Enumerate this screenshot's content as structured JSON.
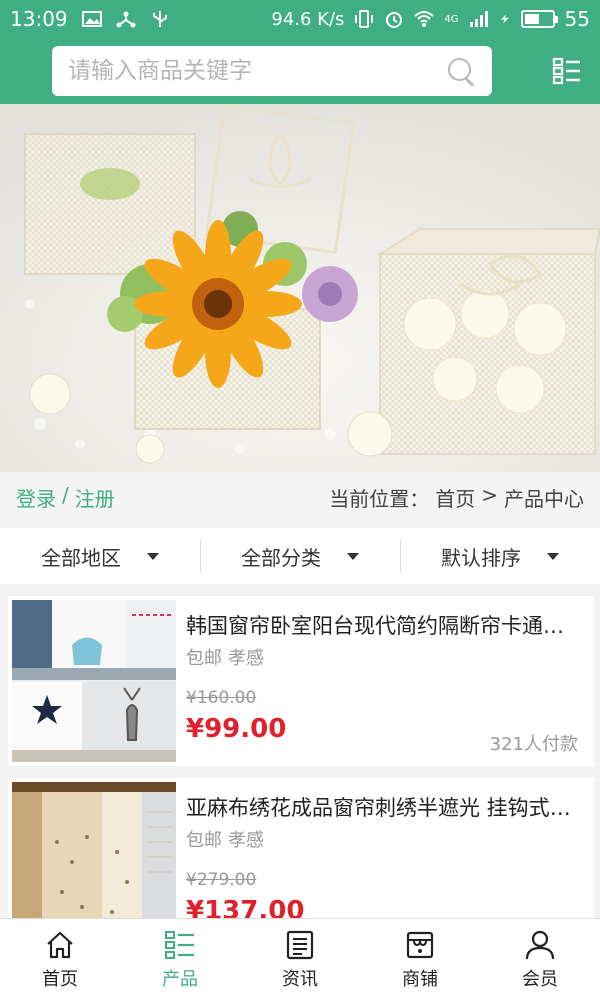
{
  "status_bar": {
    "time": "13:09",
    "speed": "94.6 K/s",
    "network": "4G",
    "battery": "55",
    "battery_level": 0.55
  },
  "search": {
    "placeholder": "请输入商品关键字"
  },
  "info_bar": {
    "login": "登录",
    "separator": "/",
    "register": "注册",
    "location_label": "当前位置：",
    "crumb_home": "首页",
    "crumb_sep": ">",
    "crumb_current": "产品中心"
  },
  "filters": [
    {
      "label": "全部地区"
    },
    {
      "label": "全部分类"
    },
    {
      "label": "默认排序"
    }
  ],
  "products": [
    {
      "name": "韩国窗帘卧室阳台现代简约隔断帘卡通窗帘",
      "shipping": "包邮",
      "location": "孝感",
      "old_price": "¥160.00",
      "price": "¥99.00",
      "sold": "321人付款"
    },
    {
      "name": "亚麻布绣花成品窗帘刺绣半遮光 挂钩式窗帘",
      "shipping": "包邮",
      "location": "孝感",
      "old_price": "¥279.00",
      "price": "¥137.00",
      "sold": ""
    }
  ],
  "tabs": [
    {
      "label": "首页",
      "icon": "home-icon",
      "active": false
    },
    {
      "label": "产品",
      "icon": "list-icon",
      "active": true
    },
    {
      "label": "资讯",
      "icon": "news-icon",
      "active": false
    },
    {
      "label": "商铺",
      "icon": "shop-icon",
      "active": false
    },
    {
      "label": "会员",
      "icon": "user-icon",
      "active": false
    }
  ],
  "colors": {
    "brand": "#3fae83",
    "price": "#e0202a"
  }
}
